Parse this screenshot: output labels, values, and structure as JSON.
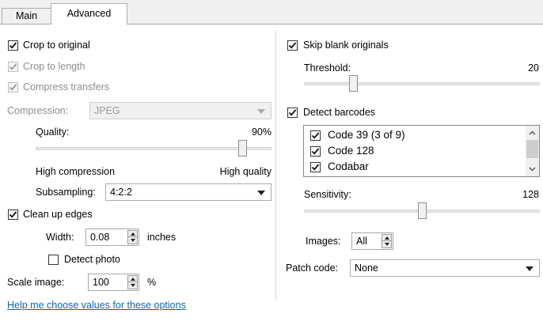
{
  "tabs": [
    {
      "label": "Main"
    },
    {
      "label": "Advanced"
    }
  ],
  "left": {
    "crop_to_original": {
      "label": "Crop to original",
      "checked": true
    },
    "crop_to_length": {
      "label": "Crop to length",
      "checked": true,
      "disabled": true
    },
    "compress_transfers": {
      "label": "Compress transfers",
      "checked": true,
      "disabled": true
    },
    "compression": {
      "label": "Compression:",
      "value": "JPEG"
    },
    "quality": {
      "label": "Quality:",
      "value": "90%",
      "level": 0.9,
      "low_label": "High compression",
      "high_label": "High quality"
    },
    "subsampling": {
      "label": "Subsampling:",
      "value": "4:2:2"
    },
    "clean_up_edges": {
      "label": "Clean up edges",
      "checked": true
    },
    "width": {
      "label": "Width:",
      "value": "0.08",
      "unit": "inches"
    },
    "detect_photo": {
      "label": "Detect photo",
      "checked": false
    },
    "scale_image": {
      "label": "Scale image:",
      "value": "100",
      "unit": "%"
    }
  },
  "help_link": "Help me choose values for these options",
  "right": {
    "skip_blank": {
      "label": "Skip blank originals",
      "checked": true
    },
    "threshold": {
      "label": "Threshold:",
      "value": "20",
      "level": 0.2
    },
    "detect_barcodes": {
      "label": "Detect barcodes",
      "checked": true
    },
    "barcodes": [
      {
        "label": "Code 39 (3 of 9)",
        "checked": true
      },
      {
        "label": "Code 128",
        "checked": true
      },
      {
        "label": "Codabar",
        "checked": true
      }
    ],
    "sensitivity": {
      "label": "Sensitivity:",
      "value": "128",
      "level": 0.5
    },
    "images": {
      "label": "Images:",
      "value": "All"
    },
    "patch_code": {
      "label": "Patch code:",
      "value": "None"
    }
  }
}
